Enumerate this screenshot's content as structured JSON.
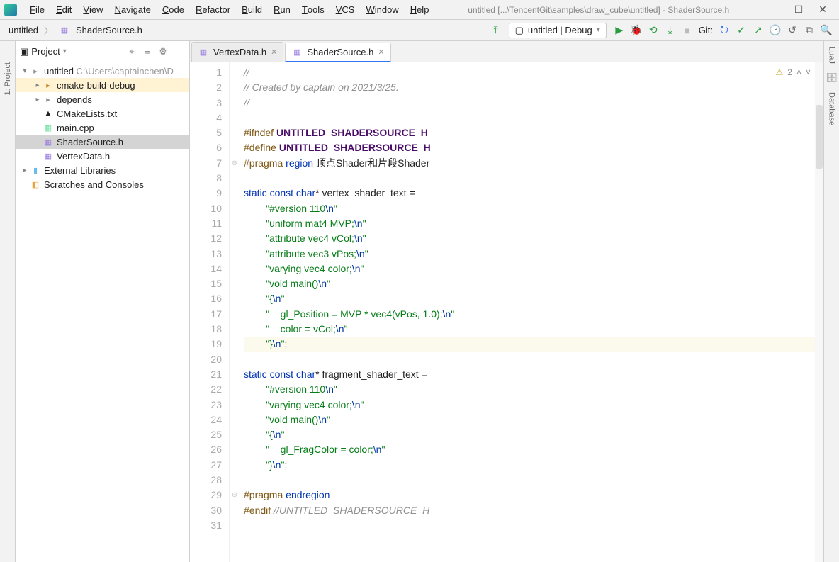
{
  "window": {
    "title": "untitled [...\\TencentGit\\samples\\draw_cube\\untitled] - ShaderSource.h"
  },
  "menu": [
    "File",
    "Edit",
    "View",
    "Navigate",
    "Code",
    "Refactor",
    "Build",
    "Run",
    "Tools",
    "VCS",
    "Window",
    "Help"
  ],
  "breadcrumb": {
    "project": "untitled",
    "file": "ShaderSource.h"
  },
  "run_config": "untitled | Debug",
  "git_label": "Git:",
  "project_pane": {
    "title": "Project"
  },
  "tree": {
    "root": {
      "name": "untitled",
      "path": "C:\\Users\\captainchen\\D"
    },
    "items": [
      {
        "name": "cmake-build-debug",
        "type": "dir",
        "hl": true
      },
      {
        "name": "depends",
        "type": "dir"
      },
      {
        "name": "CMakeLists.txt",
        "type": "cm"
      },
      {
        "name": "main.cpp",
        "type": "cpp"
      },
      {
        "name": "ShaderSource.h",
        "type": "h",
        "selected": true
      },
      {
        "name": "VertexData.h",
        "type": "h"
      }
    ],
    "ext_lib": "External Libraries",
    "scratch": "Scratches and Consoles"
  },
  "tabs": [
    {
      "label": "VertexData.h",
      "active": false
    },
    {
      "label": "ShaderSource.h",
      "active": true
    }
  ],
  "corner": {
    "warn_count": "2"
  },
  "code": {
    "lines": [
      {
        "n": 1,
        "seg": [
          {
            "t": "//",
            "c": "c-comment"
          }
        ]
      },
      {
        "n": 2,
        "seg": [
          {
            "t": "// Created by captain on 2021/3/25.",
            "c": "c-comment"
          }
        ]
      },
      {
        "n": 3,
        "seg": [
          {
            "t": "//",
            "c": "c-comment"
          }
        ]
      },
      {
        "n": 4,
        "seg": []
      },
      {
        "n": 5,
        "seg": [
          {
            "t": "#ifndef ",
            "c": "c-macro"
          },
          {
            "t": "UNTITLED_SHADERSOURCE_H",
            "c": "c-macro-name"
          }
        ]
      },
      {
        "n": 6,
        "seg": [
          {
            "t": "#define ",
            "c": "c-macro"
          },
          {
            "t": "UNTITLED_SHADERSOURCE_H",
            "c": "c-macro-name"
          }
        ]
      },
      {
        "n": 7,
        "seg": [
          {
            "t": "#pragma ",
            "c": "c-macro"
          },
          {
            "t": "region ",
            "c": "c-key"
          },
          {
            "t": "顶点Shader和片段Shader",
            "c": "c-ident"
          }
        ],
        "fold": "⊖"
      },
      {
        "n": 8,
        "seg": []
      },
      {
        "n": 9,
        "seg": [
          {
            "t": "static const char",
            "c": "c-key"
          },
          {
            "t": "* vertex_shader_text =",
            "c": "c-ident"
          }
        ]
      },
      {
        "n": 10,
        "seg": [
          {
            "t": "        ",
            "c": ""
          },
          {
            "t": "\"#version 110",
            "c": "c-str"
          },
          {
            "t": "\\n",
            "c": "c-esc"
          },
          {
            "t": "\"",
            "c": "c-str"
          }
        ]
      },
      {
        "n": 11,
        "seg": [
          {
            "t": "        ",
            "c": ""
          },
          {
            "t": "\"uniform mat4 MVP;",
            "c": "c-str"
          },
          {
            "t": "\\n",
            "c": "c-esc"
          },
          {
            "t": "\"",
            "c": "c-str"
          }
        ]
      },
      {
        "n": 12,
        "seg": [
          {
            "t": "        ",
            "c": ""
          },
          {
            "t": "\"attribute vec4 vCol;",
            "c": "c-str"
          },
          {
            "t": "\\n",
            "c": "c-esc"
          },
          {
            "t": "\"",
            "c": "c-str"
          }
        ]
      },
      {
        "n": 13,
        "seg": [
          {
            "t": "        ",
            "c": ""
          },
          {
            "t": "\"attribute vec3 vPos;",
            "c": "c-str"
          },
          {
            "t": "\\n",
            "c": "c-esc"
          },
          {
            "t": "\"",
            "c": "c-str"
          }
        ]
      },
      {
        "n": 14,
        "seg": [
          {
            "t": "        ",
            "c": ""
          },
          {
            "t": "\"varying vec4 color;",
            "c": "c-str"
          },
          {
            "t": "\\n",
            "c": "c-esc"
          },
          {
            "t": "\"",
            "c": "c-str"
          }
        ]
      },
      {
        "n": 15,
        "seg": [
          {
            "t": "        ",
            "c": ""
          },
          {
            "t": "\"void main()",
            "c": "c-str"
          },
          {
            "t": "\\n",
            "c": "c-esc"
          },
          {
            "t": "\"",
            "c": "c-str"
          }
        ]
      },
      {
        "n": 16,
        "seg": [
          {
            "t": "        ",
            "c": ""
          },
          {
            "t": "\"{",
            "c": "c-str"
          },
          {
            "t": "\\n",
            "c": "c-esc"
          },
          {
            "t": "\"",
            "c": "c-str"
          }
        ]
      },
      {
        "n": 17,
        "seg": [
          {
            "t": "        ",
            "c": ""
          },
          {
            "t": "\"    gl_Position = MVP * vec4(vPos, 1.0);",
            "c": "c-str"
          },
          {
            "t": "\\n",
            "c": "c-esc"
          },
          {
            "t": "\"",
            "c": "c-str"
          }
        ]
      },
      {
        "n": 18,
        "seg": [
          {
            "t": "        ",
            "c": ""
          },
          {
            "t": "\"    color = vCol;",
            "c": "c-str"
          },
          {
            "t": "\\n",
            "c": "c-esc"
          },
          {
            "t": "\"",
            "c": "c-str"
          }
        ]
      },
      {
        "n": 19,
        "cur": true,
        "seg": [
          {
            "t": "        ",
            "c": ""
          },
          {
            "t": "\"}",
            "c": "c-str"
          },
          {
            "t": "\\n",
            "c": "c-esc"
          },
          {
            "t": "\"",
            "c": "c-str"
          },
          {
            "t": ";",
            "c": "c-ident"
          }
        ]
      },
      {
        "n": 20,
        "seg": []
      },
      {
        "n": 21,
        "seg": [
          {
            "t": "static const char",
            "c": "c-key"
          },
          {
            "t": "* fragment_shader_text =",
            "c": "c-ident"
          }
        ]
      },
      {
        "n": 22,
        "seg": [
          {
            "t": "        ",
            "c": ""
          },
          {
            "t": "\"#version 110",
            "c": "c-str"
          },
          {
            "t": "\\n",
            "c": "c-esc"
          },
          {
            "t": "\"",
            "c": "c-str"
          }
        ]
      },
      {
        "n": 23,
        "seg": [
          {
            "t": "        ",
            "c": ""
          },
          {
            "t": "\"varying vec4 color;",
            "c": "c-str"
          },
          {
            "t": "\\n",
            "c": "c-esc"
          },
          {
            "t": "\"",
            "c": "c-str"
          }
        ]
      },
      {
        "n": 24,
        "seg": [
          {
            "t": "        ",
            "c": ""
          },
          {
            "t": "\"void main()",
            "c": "c-str"
          },
          {
            "t": "\\n",
            "c": "c-esc"
          },
          {
            "t": "\"",
            "c": "c-str"
          }
        ]
      },
      {
        "n": 25,
        "seg": [
          {
            "t": "        ",
            "c": ""
          },
          {
            "t": "\"{",
            "c": "c-str"
          },
          {
            "t": "\\n",
            "c": "c-esc"
          },
          {
            "t": "\"",
            "c": "c-str"
          }
        ]
      },
      {
        "n": 26,
        "seg": [
          {
            "t": "        ",
            "c": ""
          },
          {
            "t": "\"    gl_FragColor = color;",
            "c": "c-str"
          },
          {
            "t": "\\n",
            "c": "c-esc"
          },
          {
            "t": "\"",
            "c": "c-str"
          }
        ]
      },
      {
        "n": 27,
        "seg": [
          {
            "t": "        ",
            "c": ""
          },
          {
            "t": "\"}",
            "c": "c-str"
          },
          {
            "t": "\\n",
            "c": "c-esc"
          },
          {
            "t": "\"",
            "c": "c-str"
          },
          {
            "t": ";",
            "c": "c-ident"
          }
        ]
      },
      {
        "n": 28,
        "seg": []
      },
      {
        "n": 29,
        "seg": [
          {
            "t": "#pragma ",
            "c": "c-macro"
          },
          {
            "t": "endregion",
            "c": "c-key"
          }
        ],
        "fold": "⊖"
      },
      {
        "n": 30,
        "seg": [
          {
            "t": "#endif ",
            "c": "c-macro"
          },
          {
            "t": "//UNTITLED_SHADERSOURCE_H",
            "c": "c-comment"
          }
        ]
      },
      {
        "n": 31,
        "seg": []
      }
    ]
  },
  "side_tools": {
    "left": "1: Project",
    "right1": "LuaJ",
    "right2": "Database"
  }
}
